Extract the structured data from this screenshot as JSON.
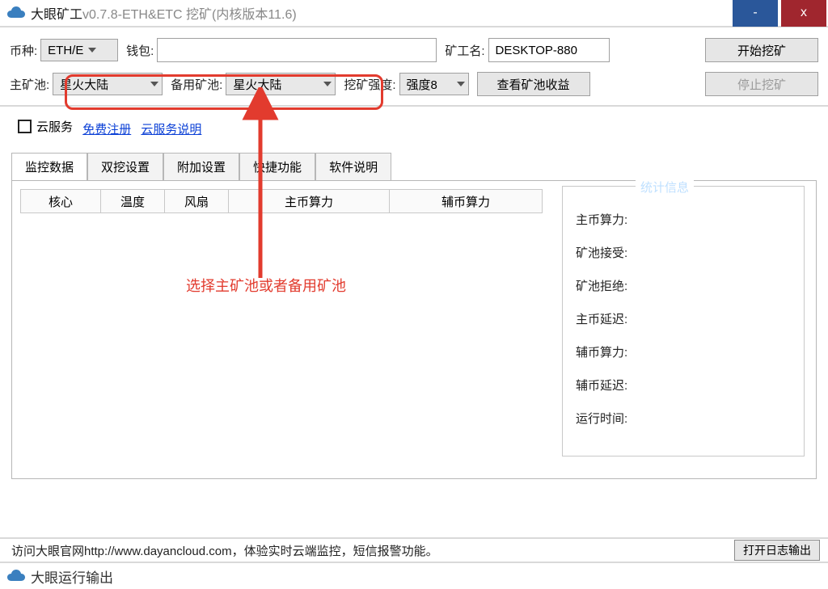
{
  "titlebar": {
    "app_name_bold": "大眼矿工",
    "version": "v0.7.8",
    "suffix": "-ETH&ETC 挖矿(内核版本11.6)",
    "min_label": "-",
    "close_label": "x"
  },
  "row1": {
    "coin_label": "币种:",
    "coin_value": "ETH/E",
    "wallet_label": "钱包:",
    "wallet_value": "",
    "miner_label": "矿工名:",
    "miner_value": "DESKTOP-880",
    "start_btn": "开始挖矿"
  },
  "row2": {
    "pool_label": "主矿池:",
    "pool_value": "星火大陆",
    "backup_label": "备用矿池:",
    "backup_value": "星火大陆",
    "intensity_label": "挖矿强度:",
    "intensity_value": "强度8",
    "profit_btn": "查看矿池收益",
    "stop_btn": "停止挖矿"
  },
  "cloud": {
    "service_label": "云服务",
    "register_link": "免费注册",
    "help_link": "云服务说明"
  },
  "tabs": [
    "监控数据",
    "双挖设置",
    "附加设置",
    "快捷功能",
    "软件说明"
  ],
  "table_headers": [
    "核心",
    "温度",
    "风扇",
    "主币算力",
    "辅币算力"
  ],
  "stats": {
    "title": "统计信息",
    "lines": [
      "主币算力:",
      "矿池接受:",
      "矿池拒绝:",
      "主币延迟:",
      "辅币算力:",
      "辅币延迟:",
      "运行时间:"
    ]
  },
  "annotation": "选择主矿池或者备用矿池",
  "footer": {
    "text": "访问大眼官网http://www.dayancloud.com，体验实时云端监控，短信报警功能。",
    "open_log_btn": "打开日志输出"
  },
  "titlebar2": {
    "text": "大眼运行输出"
  }
}
